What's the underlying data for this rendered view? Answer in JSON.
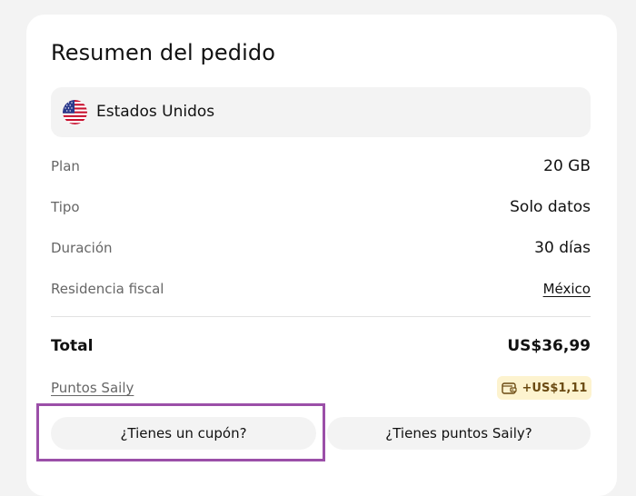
{
  "order_summary": {
    "title": "Resumen del pedido",
    "country": {
      "name": "Estados Unidos",
      "flag_icon": "us-flag-icon"
    },
    "details": [
      {
        "label": "Plan",
        "value": "20 GB"
      },
      {
        "label": "Tipo",
        "value": "Solo datos"
      },
      {
        "label": "Duración",
        "value": "30 días"
      },
      {
        "label": "Residencia fiscal",
        "value": "México"
      }
    ],
    "total": {
      "label": "Total",
      "value": "US$36,99"
    },
    "points": {
      "link_label": "Puntos Saily",
      "badge_value": "+US$1,11",
      "badge_icon": "wallet-icon"
    },
    "actions": {
      "coupon_label": "¿Tienes un cupón?",
      "points_label": "¿Tienes puntos Saily?"
    }
  },
  "colors": {
    "page_background": "#f3f3f3",
    "card_background": "#ffffff",
    "muted_text": "#666666",
    "badge_background": "#fdf3cf",
    "highlight_border": "#9b4fa8"
  }
}
